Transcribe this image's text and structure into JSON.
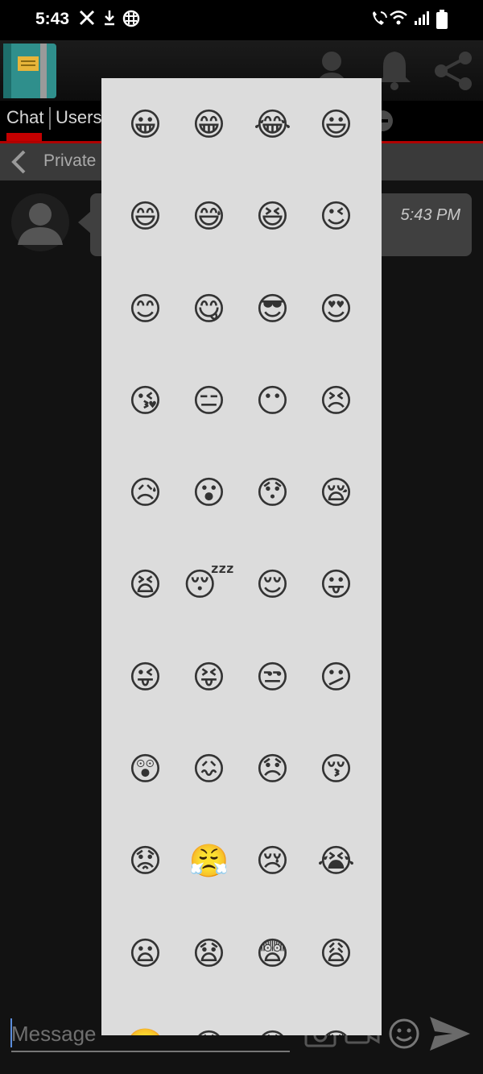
{
  "status_bar": {
    "time": "5:43",
    "icons": [
      "x-logo-icon",
      "download-icon",
      "grid-app-icon",
      "wifi-calling-icon",
      "wifi-icon",
      "signal-icon",
      "battery-icon"
    ]
  },
  "tabs": {
    "chat_label": "Chat",
    "users_label": "Users"
  },
  "private_bar": {
    "label": "Private"
  },
  "message": {
    "time": "5:43 PM"
  },
  "input": {
    "placeholder": "Message"
  },
  "colors": {
    "accent_red": "#c40000",
    "panel_bg": "#dcdcdc",
    "app_bg": "#121212"
  },
  "emoji_picker": {
    "emojis": [
      "😀",
      "😁",
      "😂",
      "😃",
      "😄",
      "😅",
      "😆",
      "😉",
      "😊",
      "😋",
      "😎",
      "😍",
      "😘",
      "😑",
      "😶",
      "😣",
      "😥",
      "😮",
      "😯",
      "😪",
      "😫",
      "😴",
      "😌",
      "😛",
      "😜",
      "😝",
      "😒",
      "😕",
      "😲",
      "😖",
      "😞",
      "😚",
      "😟",
      "😤",
      "😢",
      "😭",
      "😦",
      "😧",
      "😨",
      "😩",
      "😬",
      "😰",
      "😱",
      "😳"
    ]
  }
}
